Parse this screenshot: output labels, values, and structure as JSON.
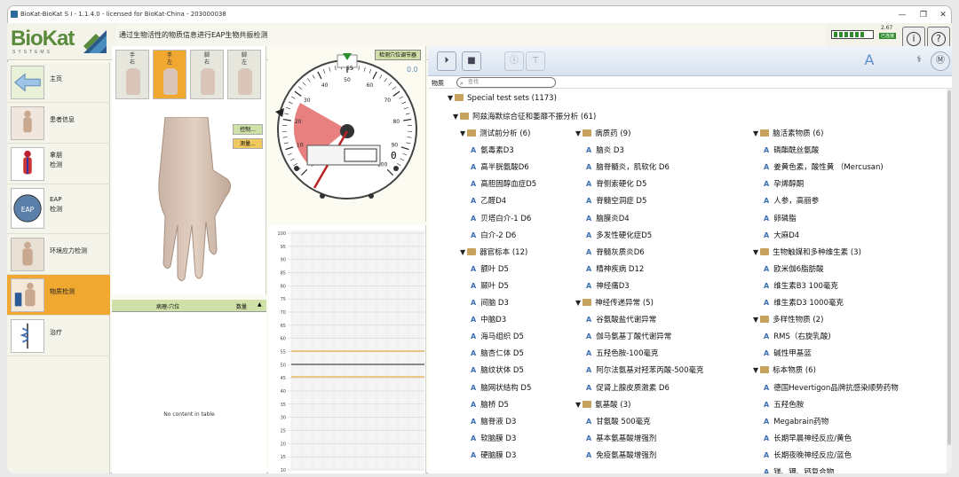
{
  "window": {
    "title": "BioKat-BioKat S I - 1.1.4.0 -  licensed for BioKat-China - 203000038",
    "controls": [
      "—",
      "❐",
      "✕"
    ]
  },
  "logo": {
    "text": "BioKat",
    "sub": "SYSTEMS"
  },
  "banner": {
    "text": "通过生物活性的物质信息进行EAP生物共振检测"
  },
  "battery": {
    "value": "2.67",
    "status": "已连接"
  },
  "header_buttons": {
    "info": "i",
    "help": "?"
  },
  "sidebar": {
    "items": [
      {
        "label": "主页"
      },
      {
        "label": "患者信息"
      },
      {
        "label": "拿朋\n检测"
      },
      {
        "label": "EAP\n检测"
      },
      {
        "label": "环境应力检测"
      },
      {
        "label": "物质检测"
      },
      {
        "label": "治疗"
      }
    ],
    "active_index": 5
  },
  "finger_tabs": [
    {
      "label": "手\n右"
    },
    {
      "label": "手\n左"
    },
    {
      "label": "脚\n右"
    },
    {
      "label": "脚\n左"
    }
  ],
  "hand_buttons": {
    "control": "控制...",
    "measure": "测量..."
  },
  "point_table": {
    "col_point": "病理-穴位",
    "col_count": "数量",
    "empty": "No content in table"
  },
  "dial": {
    "calibrate": "检测穴位调节器",
    "reading": "0.0",
    "display": "0",
    "ticks": [
      "0",
      "10",
      "20",
      "30",
      "40",
      "50",
      "60",
      "70",
      "80",
      "90",
      "100"
    ],
    "marker": "55"
  },
  "graph": {
    "y_ticks": [
      "100",
      "95",
      "90",
      "85",
      "80",
      "75",
      "70",
      "65",
      "60",
      "55",
      "50",
      "45",
      "40",
      "35",
      "30",
      "25",
      "20",
      "15",
      "10"
    ]
  },
  "toolbar": {
    "font_label": "A"
  },
  "search": {
    "label": "物质",
    "placeholder": "查找"
  },
  "tree": {
    "root": "Special test sets (1173)",
    "group": "阿兹海默综合征和萎靡不振分析 (61)",
    "col1": [
      {
        "type": "folder",
        "label": "测试前分析 (6)"
      },
      {
        "type": "item",
        "label": "氨毒素D3"
      },
      {
        "type": "item",
        "label": "高半胱氨酸D6"
      },
      {
        "type": "item",
        "label": "高胆固醇血症D5"
      },
      {
        "type": "item",
        "label": "乙醛D4"
      },
      {
        "type": "item",
        "label": "贝塔白介-1 D6"
      },
      {
        "type": "item",
        "label": "白介-2 D6"
      },
      {
        "type": "folder",
        "label": "器官标本 (12)"
      },
      {
        "type": "item",
        "label": "额叶 D5"
      },
      {
        "type": "item",
        "label": "颞叶 D5"
      },
      {
        "type": "item",
        "label": "间脑 D3"
      },
      {
        "type": "item",
        "label": "中脑D3"
      },
      {
        "type": "item",
        "label": "海马组织 D5"
      },
      {
        "type": "item",
        "label": "脑杏仁体 D5"
      },
      {
        "type": "item",
        "label": "脑纹状体 D5"
      },
      {
        "type": "item",
        "label": "脑网状结构 D5"
      },
      {
        "type": "item",
        "label": "脑桥 D5"
      },
      {
        "type": "item",
        "label": "脑脊液 D3"
      },
      {
        "type": "item",
        "label": "软脑膜 D3"
      },
      {
        "type": "item",
        "label": "硬脑膜 D3"
      }
    ],
    "col2": [
      {
        "type": "folder",
        "label": "病质药 (9)"
      },
      {
        "type": "item",
        "label": "脑炎 D3"
      },
      {
        "type": "item",
        "label": "脑脊髓炎，肌软化 D6"
      },
      {
        "type": "item",
        "label": "脊侧索硬化 D5"
      },
      {
        "type": "item",
        "label": "脊髓空洞症 D5"
      },
      {
        "type": "item",
        "label": "脑膜炎D4"
      },
      {
        "type": "item",
        "label": "多发性硬化症D5"
      },
      {
        "type": "item",
        "label": "脊髓灰质炎D6"
      },
      {
        "type": "item",
        "label": "精神疾病 D12"
      },
      {
        "type": "item",
        "label": "神经痛D3"
      },
      {
        "type": "folder",
        "label": "神经传递异常 (5)"
      },
      {
        "type": "item",
        "label": "谷氨酸盐代谢异常"
      },
      {
        "type": "item",
        "label": "伽马氨基丁酸代谢异常"
      },
      {
        "type": "item",
        "label": "五羟色胺-100毫克"
      },
      {
        "type": "item",
        "label": "阿尔法氨基对羟苯丙酸-500毫克"
      },
      {
        "type": "item",
        "label": "促肾上腺皮质激素 D6"
      },
      {
        "type": "folder",
        "label": "氨基酸 (3)"
      },
      {
        "type": "item",
        "label": "甘氨酸 500毫克"
      },
      {
        "type": "item",
        "label": "基本氨基酸增强剂"
      },
      {
        "type": "item",
        "label": "免疫氨基酸增强剂"
      }
    ],
    "col3": [
      {
        "type": "folder",
        "label": "脑活素物质 (6)"
      },
      {
        "type": "item",
        "label": "磷酯酰丝氨酸"
      },
      {
        "type": "item",
        "label": "姜黄色素，酸性黄 （Mercusan)"
      },
      {
        "type": "item",
        "label": "孕烯醇酮"
      },
      {
        "type": "item",
        "label": "人参，高丽参"
      },
      {
        "type": "item",
        "label": "卵磷脂"
      },
      {
        "type": "item",
        "label": "大麻D4"
      },
      {
        "type": "folder",
        "label": "生物触媒和多种维生素 (3)"
      },
      {
        "type": "item",
        "label": "欧米伽6脂肪酸"
      },
      {
        "type": "item",
        "label": "维生素B3 100毫克"
      },
      {
        "type": "item",
        "label": "维生素D3 1000毫克"
      },
      {
        "type": "folder",
        "label": "多样性物质 (2)"
      },
      {
        "type": "item",
        "label": "RMS（右旋乳酸)"
      },
      {
        "type": "item",
        "label": "碱性甲基蓝"
      },
      {
        "type": "folder",
        "label": "标本物质 (6)"
      },
      {
        "type": "item",
        "label": "德国Hevertigon品牌抗感染顺势药物"
      },
      {
        "type": "item",
        "label": "五羟色胺"
      },
      {
        "type": "item",
        "label": "Megabrain药物"
      },
      {
        "type": "item",
        "label": "长期早晨神经反应/黄色"
      },
      {
        "type": "item",
        "label": "长期夜晚神经反应/蓝色"
      },
      {
        "type": "item",
        "label": "镁、钾、钙复合物"
      }
    ]
  },
  "colors": {
    "accent_orange": "#f0a830",
    "brand_green": "#5a8a3c",
    "tree_icon_blue": "#3d6fb3",
    "dial_red": "#e56a6a"
  }
}
